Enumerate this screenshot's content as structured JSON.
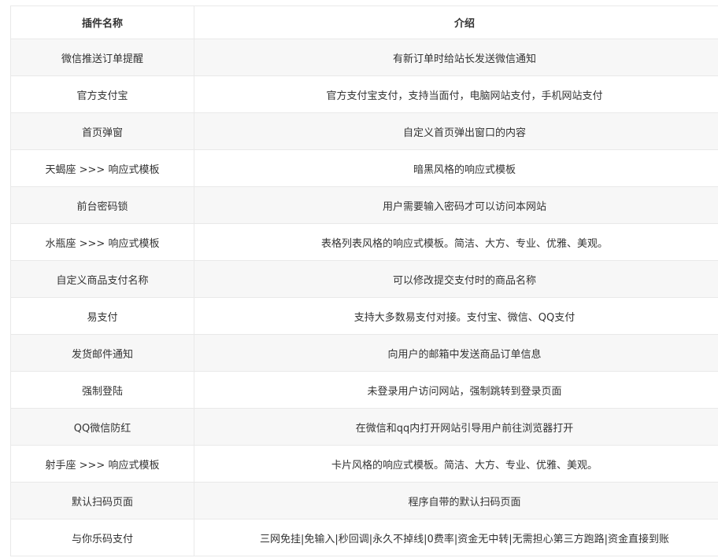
{
  "table": {
    "headers": [
      "插件名称",
      "介绍"
    ],
    "rows": [
      {
        "name": "微信推送订单提醒",
        "desc": "有新订单时给站长发送微信通知"
      },
      {
        "name": "官方支付宝",
        "desc": "官方支付宝支付，支持当面付，电脑网站支付，手机网站支付"
      },
      {
        "name": "首页弹窗",
        "desc": "自定义首页弹出窗口的内容"
      },
      {
        "name": "天蝎座 >>> 响应式模板",
        "desc": "暗黑风格的响应式模板"
      },
      {
        "name": "前台密码锁",
        "desc": "用户需要输入密码才可以访问本网站"
      },
      {
        "name": "水瓶座 >>> 响应式模板",
        "desc": "表格列表风格的响应式模板。简洁、大方、专业、优雅、美观。"
      },
      {
        "name": "自定义商品支付名称",
        "desc": "可以修改提交支付时的商品名称"
      },
      {
        "name": "易支付",
        "desc": "支持大多数易支付对接。支付宝、微信、QQ支付"
      },
      {
        "name": "发货邮件通知",
        "desc": "向用户的邮箱中发送商品订单信息"
      },
      {
        "name": "强制登陆",
        "desc": "未登录用户访问网站，强制跳转到登录页面"
      },
      {
        "name": "QQ微信防红",
        "desc": "在微信和qq内打开网站引导用户前往浏览器打开"
      },
      {
        "name": "射手座 >>> 响应式模板",
        "desc": "卡片风格的响应式模板。简洁、大方、专业、优雅、美观。"
      },
      {
        "name": "默认扫码页面",
        "desc": "程序自带的默认扫码页面"
      },
      {
        "name": "与你乐码支付",
        "desc": "三网免挂|免输入|秒回调|永久不掉线|0费率|资金无中转|无需担心第三方跑路|资金直接到账"
      }
    ]
  }
}
